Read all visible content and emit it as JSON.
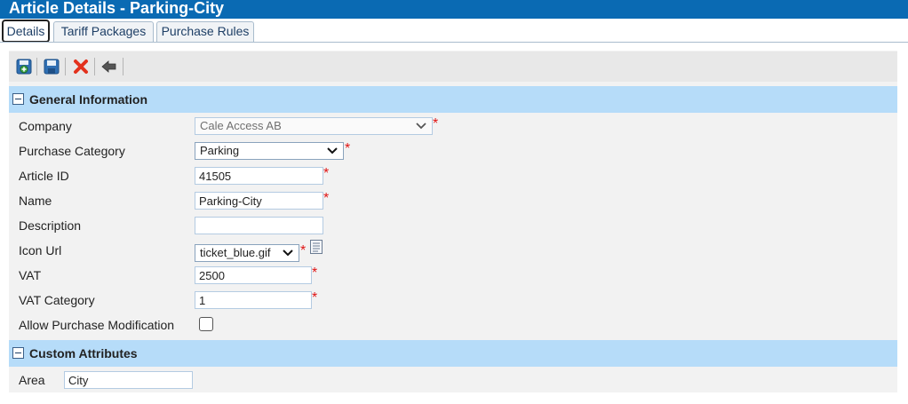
{
  "window": {
    "title": "Article Details - Parking-City"
  },
  "tabs": [
    {
      "label": "Details",
      "active": true
    },
    {
      "label": "Tariff Packages",
      "active": false
    },
    {
      "label": "Purchase Rules",
      "active": false
    }
  ],
  "toolbar": {
    "icons": [
      "save-and-new-icon",
      "save-icon",
      "delete-icon",
      "back-icon"
    ]
  },
  "general": {
    "title": "General Information",
    "fields": {
      "company": {
        "label": "Company",
        "value": "Cale Access AB"
      },
      "purchase_category": {
        "label": "Purchase Category",
        "value": "Parking"
      },
      "article_id": {
        "label": "Article ID",
        "value": "41505"
      },
      "name": {
        "label": "Name",
        "value": "Parking-City"
      },
      "description": {
        "label": "Description",
        "value": ""
      },
      "icon_url": {
        "label": "Icon Url",
        "value": "ticket_blue.gif"
      },
      "vat": {
        "label": "VAT",
        "value": "2500"
      },
      "vat_category": {
        "label": "VAT Category",
        "value": "1"
      },
      "allow_mod": {
        "label": "Allow Purchase Modification",
        "checked": false
      }
    }
  },
  "custom": {
    "title": "Custom Attributes",
    "fields": {
      "area": {
        "label": "Area",
        "value": "City"
      }
    }
  },
  "required_mark": "*",
  "colors": {
    "titlebar": "#0a6ab3",
    "section_header": "#b6dcf9",
    "required": "#e01515",
    "field_border": "#b4cbe2"
  }
}
